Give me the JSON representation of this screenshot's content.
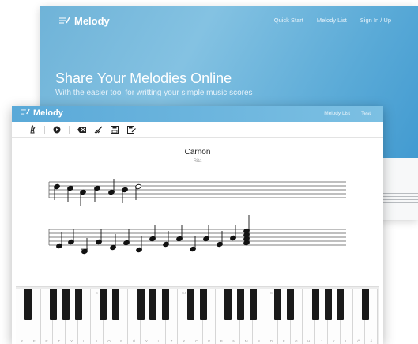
{
  "landing": {
    "brand": "Melody",
    "nav": [
      "Quick Start",
      "Melody List",
      "Sign In / Up"
    ],
    "hero_title": "Share Your Melodies Online",
    "hero_subtitle": "With the easier tool for writting your simple music scores"
  },
  "editor": {
    "brand": "Melody",
    "nav": [
      "Melody List",
      "Test"
    ],
    "toolbar": [
      {
        "icon": "metronome-icon"
      },
      {
        "icon": "play-icon"
      },
      {
        "icon": "delete-icon"
      },
      {
        "icon": "clear-icon"
      },
      {
        "icon": "save-icon"
      },
      {
        "icon": "save-as-icon"
      }
    ],
    "score": {
      "title": "Carnon",
      "author": "Rita"
    }
  },
  "piano": {
    "octave_labels": [
      "C",
      "C4",
      "C"
    ],
    "key_labels": [
      "R",
      "E",
      "R",
      "T",
      "Y",
      "U",
      "I",
      "O",
      "P",
      "Ü",
      "Y",
      "U",
      "Z",
      "X",
      "C",
      "V",
      "B",
      "N",
      "M",
      "S",
      "D",
      "F",
      "G",
      "H",
      "J",
      "K",
      "L",
      "Ö",
      "Ä"
    ]
  },
  "colors": {
    "accent": "#5aa9d8",
    "hero_gradient_start": "#6fb3d8",
    "hero_gradient_end": "#3b96cf"
  }
}
